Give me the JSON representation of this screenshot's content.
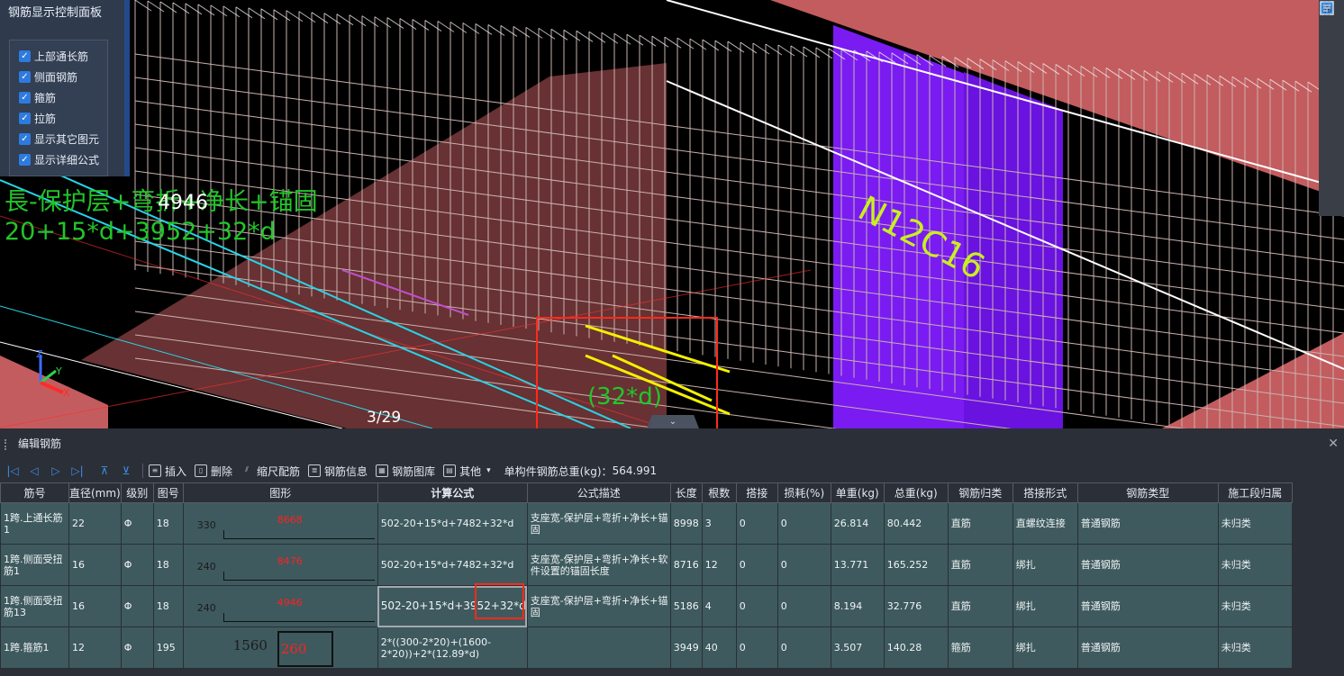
{
  "viewport": {
    "labels": {
      "formula_text_line1": "長-保护层+弯折+净长+锚固",
      "formula_text_line2": "20+15*d+3952+32*d",
      "length_value": "4946",
      "rebar_tag": "N12C16",
      "anchor_label": "(32*d)",
      "page_counter": "3/29"
    },
    "axis": {
      "x": "X",
      "y": "Y",
      "z": "Z"
    },
    "colors": {
      "beam_pink": "#c35c5f",
      "column_purple": "#7a1bf2",
      "annotation_green": "#22c52a",
      "rebar_yellow": "#f4f000",
      "rebar_cyan": "#27d4e6",
      "highlight_red": "#ff2b1a"
    }
  },
  "control_panel": {
    "title": "钢筋显示控制面板",
    "options": [
      {
        "label": "上部通长筋",
        "checked": true
      },
      {
        "label": "侧面钢筋",
        "checked": true
      },
      {
        "label": "箍筋",
        "checked": true
      },
      {
        "label": "拉筋",
        "checked": true
      },
      {
        "label": "显示其它图元",
        "checked": true
      },
      {
        "label": "显示详细公式",
        "checked": true
      }
    ]
  },
  "right_toolbar": [
    "orbit-icon",
    "2d-view-icon",
    "3d-box-icon",
    "3d-cube-blue-icon",
    "fullscreen-icon",
    "component-icon",
    "properties-list-icon"
  ],
  "editor": {
    "title": "编辑钢筋",
    "toolbar": {
      "insert": "插入",
      "delete": "删除",
      "scale_rebar": "缩尺配筋",
      "rebar_info": "钢筋信息",
      "rebar_library": "钢筋图库",
      "other": "其他",
      "total_weight_label": "单构件钢筋总重(kg)：",
      "total_weight_value": "564.991"
    },
    "columns": [
      "筋号",
      "直径(mm)",
      "级别",
      "图号",
      "图形",
      "计算公式",
      "公式描述",
      "长度",
      "根数",
      "搭接",
      "损耗(%)",
      "单重(kg)",
      "总重(kg)",
      "钢筋归类",
      "搭接形式",
      "钢筋类型",
      "施工段归属"
    ],
    "rows": [
      {
        "name": "1跨.上通长筋1",
        "diameter": "22",
        "grade": "Φ",
        "fig_no": "18",
        "shape_left": "330",
        "shape_value": "8668",
        "formula": "502-20+15*d+7482+32*d",
        "desc": "支座宽-保护层+弯折+净长+锚固",
        "length": "8998",
        "count": "3",
        "lap": "0",
        "loss": "0",
        "unit_w": "26.814",
        "total_w": "80.442",
        "category": "直筋",
        "lap_form": "直螺纹连接",
        "type": "普通钢筋",
        "segment": "未归类"
      },
      {
        "name": "1跨.侧面受扭筋1",
        "diameter": "16",
        "grade": "Φ",
        "fig_no": "18",
        "shape_left": "240",
        "shape_value": "8476",
        "formula": "502-20+15*d+7482+32*d",
        "desc": "支座宽-保护层+弯折+净长+软件设置的锚固长度",
        "length": "8716",
        "count": "12",
        "lap": "0",
        "loss": "0",
        "unit_w": "13.771",
        "total_w": "165.252",
        "category": "直筋",
        "lap_form": "绑扎",
        "type": "普通钢筋",
        "segment": "未归类"
      },
      {
        "name": "1跨.侧面受扭筋13",
        "diameter": "16",
        "grade": "Φ",
        "fig_no": "18",
        "shape_left": "240",
        "shape_value": "4946",
        "formula": "502-20+15*d+3952+32*d",
        "desc": "支座宽-保护层+弯折+净长+锚固",
        "length": "5186",
        "count": "4",
        "lap": "0",
        "loss": "0",
        "unit_w": "8.194",
        "total_w": "32.776",
        "category": "直筋",
        "lap_form": "绑扎",
        "type": "普通钢筋",
        "segment": "未归类"
      },
      {
        "name": "1跨.箍筋1",
        "diameter": "12",
        "grade": "Φ",
        "fig_no": "195",
        "shape_left": "1560",
        "shape_value": "260",
        "formula": "2*((300-2*20)+(1600-2*20))+2*(12.89*d)",
        "desc": "",
        "length": "3949",
        "count": "40",
        "lap": "0",
        "loss": "0",
        "unit_w": "3.507",
        "total_w": "140.28",
        "category": "箍筋",
        "lap_form": "绑扎",
        "type": "普通钢筋",
        "segment": "未归类"
      }
    ]
  }
}
